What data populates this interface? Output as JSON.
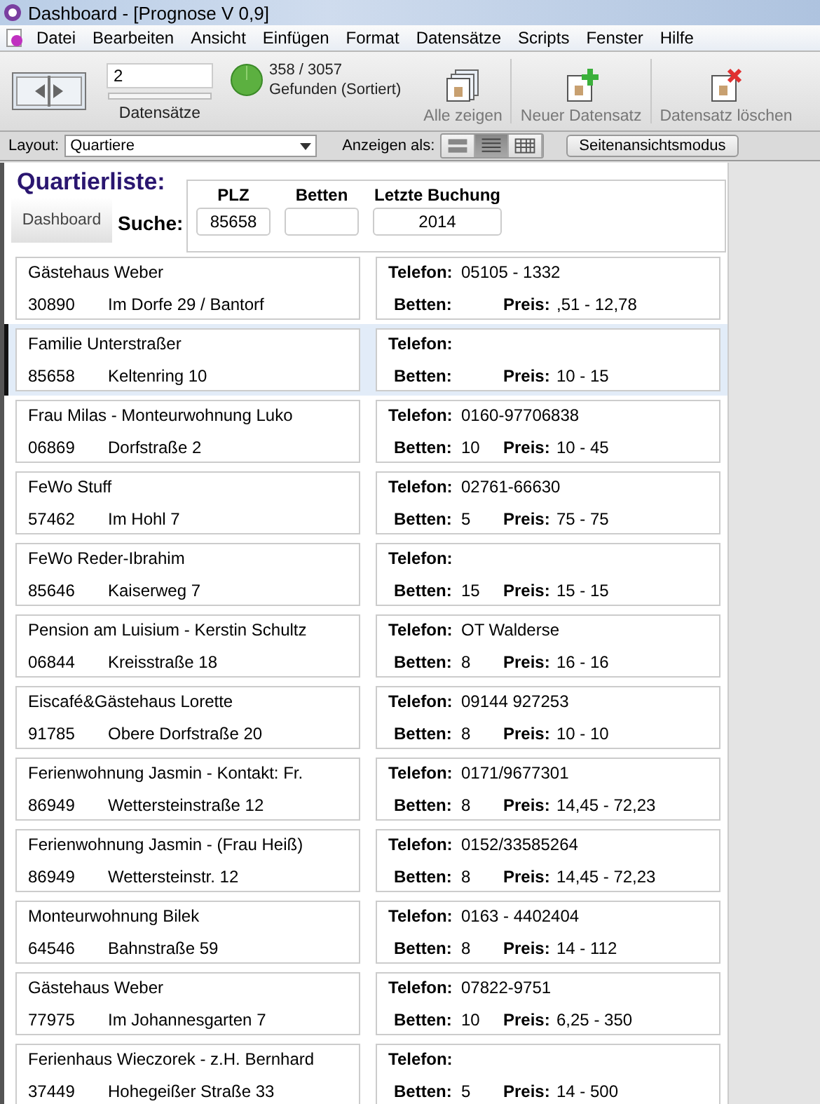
{
  "window": {
    "title": "Dashboard - [Prognose V 0,9]"
  },
  "menu": [
    {
      "label": "Datei"
    },
    {
      "label": "Bearbeiten"
    },
    {
      "label": "Ansicht"
    },
    {
      "label": "Einfügen"
    },
    {
      "label": "Format"
    },
    {
      "label": "Datensätze"
    },
    {
      "label": "Scripts"
    },
    {
      "label": "Fenster"
    },
    {
      "label": "Hilfe"
    }
  ],
  "toolbar": {
    "record_number": "2",
    "records_label": "Datensätze",
    "found_count": "358 / 3057",
    "found_status": "Gefunden (Sortiert)",
    "buttons": [
      {
        "label": "Alle zeigen",
        "kind": "show-all"
      },
      {
        "label": "Neuer Datensatz",
        "kind": "new"
      },
      {
        "label": "Datensatz löschen",
        "kind": "delete"
      }
    ]
  },
  "layout_bar": {
    "layout_label": "Layout:",
    "layout_value": "Quartiere",
    "view_label": "Anzeigen als:",
    "view_modes": [
      {
        "kind": "form",
        "selected": false
      },
      {
        "kind": "list",
        "selected": true
      },
      {
        "kind": "table",
        "selected": false
      }
    ],
    "preview_button": "Seitenansichtsmodus"
  },
  "header": {
    "title": "Quartierliste:",
    "dashboard_button": "Dashboard",
    "search_label": "Suche:",
    "search_fields": [
      {
        "label": "PLZ",
        "value": "85658"
      },
      {
        "label": "Betten"
      },
      {
        "label": "Letzte Buchung",
        "value": "2014"
      }
    ]
  },
  "records": [
    {
      "name": "Gästehaus Weber",
      "zip": "30890",
      "street": "Im Dorfe 29 / Bantorf",
      "phone_label": "Telefon:",
      "phone": "05105 - 1332",
      "beds_label": "Betten:",
      "price_label": "Preis:",
      "price": ",51 - 12,78",
      "selected": false
    },
    {
      "name": "Familie Unterstraßer",
      "zip": "85658",
      "street": "Keltenring 10",
      "phone_label": "Telefon:",
      "beds_label": "Betten:",
      "price_label": "Preis:",
      "price": "10 - 15",
      "selected": true
    },
    {
      "name": "Frau Milas - Monteurwohnung Luko",
      "zip": "06869",
      "street": "Dorfstraße 2",
      "phone_label": "Telefon:",
      "phone": "0160-97706838",
      "beds_label": "Betten:",
      "beds": "10",
      "price_label": "Preis:",
      "price": "10 - 45",
      "selected": false
    },
    {
      "name": "FeWo Stuff",
      "zip": "57462",
      "street": "Im Hohl 7",
      "phone_label": "Telefon:",
      "phone": "02761-66630",
      "beds_label": "Betten:",
      "beds": "5",
      "price_label": "Preis:",
      "price": "75 - 75",
      "selected": false
    },
    {
      "name": "FeWo Reder-Ibrahim",
      "zip": "85646",
      "street": "Kaiserweg 7",
      "phone_label": "Telefon:",
      "beds_label": "Betten:",
      "beds": "15",
      "price_label": "Preis:",
      "price": "15 - 15",
      "selected": false
    },
    {
      "name": "Pension am Luisium - Kerstin Schultz",
      "zip": "06844",
      "street": "Kreisstraße 18",
      "phone_label": "Telefon:",
      "phone": "OT Walderse",
      "beds_label": "Betten:",
      "beds": "8",
      "price_label": "Preis:",
      "price": "16 - 16",
      "selected": false
    },
    {
      "name": "Eiscafé&Gästehaus Lorette",
      "zip": "91785",
      "street": "Obere Dorfstraße 20",
      "phone_label": "Telefon:",
      "phone": "09144 927253",
      "beds_label": "Betten:",
      "beds": "8",
      "price_label": "Preis:",
      "price": "10 - 10",
      "selected": false
    },
    {
      "name": "Ferienwohnung Jasmin - Kontakt: Fr.",
      "zip": "86949",
      "street": "Wettersteinstraße 12",
      "phone_label": "Telefon:",
      "phone": "0171/9677301",
      "beds_label": "Betten:",
      "beds": "8",
      "price_label": "Preis:",
      "price": "14,45 - 72,23",
      "selected": false
    },
    {
      "name": "Ferienwohnung Jasmin - (Frau Heiß)",
      "zip": "86949",
      "street": "Wettersteinstr. 12",
      "phone_label": "Telefon:",
      "phone": "0152/33585264",
      "beds_label": "Betten:",
      "beds": "8",
      "price_label": "Preis:",
      "price": "14,45 - 72,23",
      "selected": false
    },
    {
      "name": "Monteurwohnung Bilek",
      "zip": "64546",
      "street": "Bahnstraße 59",
      "phone_label": "Telefon:",
      "phone": "0163 - 4402404",
      "beds_label": "Betten:",
      "beds": "8",
      "price_label": "Preis:",
      "price": "14 - 112",
      "selected": false
    },
    {
      "name": "Gästehaus Weber",
      "zip": "77975",
      "street": "Im Johannesgarten 7",
      "phone_label": "Telefon:",
      "phone": "07822-9751",
      "beds_label": "Betten:",
      "beds": "10",
      "price_label": "Preis:",
      "price": "6,25 - 350",
      "selected": false
    },
    {
      "name": "Ferienhaus Wieczorek - z.H. Bernhard",
      "zip": "37449",
      "street": "Hohegeißer Straße 33",
      "phone_label": "Telefon:",
      "beds_label": "Betten:",
      "beds": "5",
      "price_label": "Preis:",
      "price": "14 - 500",
      "selected": false
    }
  ]
}
